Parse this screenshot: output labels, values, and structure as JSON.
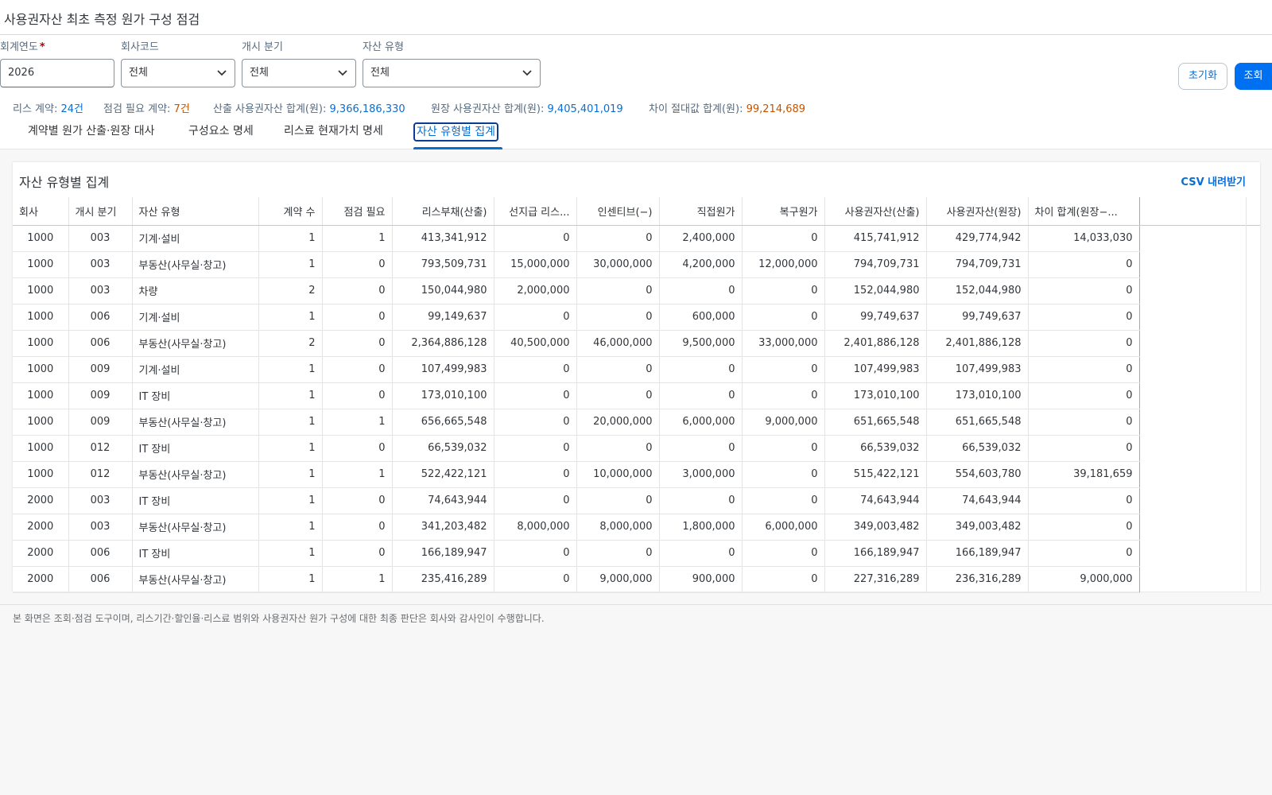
{
  "app": {
    "title": "사용권자산 최초 측정 원가 구성 점검"
  },
  "filters": {
    "fiscal_year": {
      "label": "회계연도",
      "required_mark": "*",
      "value": "2026"
    },
    "company_code": {
      "label": "회사코드",
      "value": "전체"
    },
    "start_quarter": {
      "label": "개시 분기",
      "value": "전체"
    },
    "asset_type": {
      "label": "자산 유형",
      "value": "전체"
    }
  },
  "buttons": {
    "reset": "초기화",
    "search": "조회"
  },
  "summary": {
    "contracts_label": "리스 계약:",
    "contracts_value": "24건",
    "review_label": "점검 필요 계약:",
    "review_value": "7건",
    "calc_label": "산출 사용권자산 합계(원):",
    "calc_value": "9,366,186,330",
    "ledger_label": "원장 사용권자산 합계(원):",
    "ledger_value": "9,405,401,019",
    "diff_label": "차이 절대값 합계(원):",
    "diff_value": "99,214,689"
  },
  "tabs": [
    {
      "label": "계약별 원가 산출·원장 대사"
    },
    {
      "label": "구성요소 명세"
    },
    {
      "label": "리스료 현재가치 명세"
    },
    {
      "label": "자산 유형별 집계"
    }
  ],
  "card": {
    "title": "자산 유형별 집계",
    "csv_label": "CSV 내려받기"
  },
  "table": {
    "headers": [
      "회사",
      "개시 분기",
      "자산 유형",
      "계약 수",
      "점검 필요",
      "리스부채(산출)",
      "선지급 리스...",
      "인센티브(−)",
      "직접원가",
      "복구원가",
      "사용권자산(산출)",
      "사용권자산(원장)",
      "차이 합계(원장−..."
    ],
    "rows": [
      [
        "1000",
        "003",
        "기계·설비",
        "1",
        "1",
        "413,341,912",
        "0",
        "0",
        "2,400,000",
        "0",
        "415,741,912",
        "429,774,942",
        "14,033,030"
      ],
      [
        "1000",
        "003",
        "부동산(사무실·창고)",
        "1",
        "0",
        "793,509,731",
        "15,000,000",
        "30,000,000",
        "4,200,000",
        "12,000,000",
        "794,709,731",
        "794,709,731",
        "0"
      ],
      [
        "1000",
        "003",
        "차량",
        "2",
        "0",
        "150,044,980",
        "2,000,000",
        "0",
        "0",
        "0",
        "152,044,980",
        "152,044,980",
        "0"
      ],
      [
        "1000",
        "006",
        "기계·설비",
        "1",
        "0",
        "99,149,637",
        "0",
        "0",
        "600,000",
        "0",
        "99,749,637",
        "99,749,637",
        "0"
      ],
      [
        "1000",
        "006",
        "부동산(사무실·창고)",
        "2",
        "0",
        "2,364,886,128",
        "40,500,000",
        "46,000,000",
        "9,500,000",
        "33,000,000",
        "2,401,886,128",
        "2,401,886,128",
        "0"
      ],
      [
        "1000",
        "009",
        "기계·설비",
        "1",
        "0",
        "107,499,983",
        "0",
        "0",
        "0",
        "0",
        "107,499,983",
        "107,499,983",
        "0"
      ],
      [
        "1000",
        "009",
        "IT 장비",
        "1",
        "0",
        "173,010,100",
        "0",
        "0",
        "0",
        "0",
        "173,010,100",
        "173,010,100",
        "0"
      ],
      [
        "1000",
        "009",
        "부동산(사무실·창고)",
        "1",
        "1",
        "656,665,548",
        "0",
        "20,000,000",
        "6,000,000",
        "9,000,000",
        "651,665,548",
        "651,665,548",
        "0"
      ],
      [
        "1000",
        "012",
        "IT 장비",
        "1",
        "0",
        "66,539,032",
        "0",
        "0",
        "0",
        "0",
        "66,539,032",
        "66,539,032",
        "0"
      ],
      [
        "1000",
        "012",
        "부동산(사무실·창고)",
        "1",
        "1",
        "522,422,121",
        "0",
        "10,000,000",
        "3,000,000",
        "0",
        "515,422,121",
        "554,603,780",
        "39,181,659"
      ],
      [
        "2000",
        "003",
        "IT 장비",
        "1",
        "0",
        "74,643,944",
        "0",
        "0",
        "0",
        "0",
        "74,643,944",
        "74,643,944",
        "0"
      ],
      [
        "2000",
        "003",
        "부동산(사무실·창고)",
        "1",
        "0",
        "341,203,482",
        "8,000,000",
        "8,000,000",
        "1,800,000",
        "6,000,000",
        "349,003,482",
        "349,003,482",
        "0"
      ],
      [
        "2000",
        "006",
        "IT 장비",
        "1",
        "0",
        "166,189,947",
        "0",
        "0",
        "0",
        "0",
        "166,189,947",
        "166,189,947",
        "0"
      ],
      [
        "2000",
        "006",
        "부동산(사무실·창고)",
        "1",
        "1",
        "235,416,289",
        "0",
        "9,000,000",
        "900,000",
        "0",
        "227,316,289",
        "236,316,289",
        "9,000,000"
      ]
    ]
  },
  "footnote": "본 화면은 조회·점검 도구이며, 리스기간·할인율·리스료 범위와 사용권자산 원가 구성에 대한 최종 판단은 회사와 감사인이 수행합니다.",
  "colors": {
    "accent": "#0a6ed1",
    "warning": "#c35500",
    "positive": "#107e3e",
    "negative": "#aa0808"
  }
}
